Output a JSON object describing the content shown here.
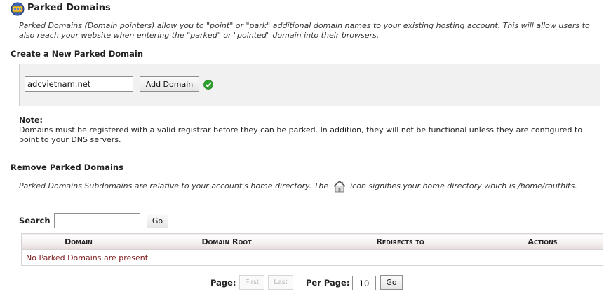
{
  "header": {
    "title": "Parked Domains",
    "icon": "parked-domains-icon",
    "intro": "Parked Domains (Domain pointers) allow you to \"point\" or \"park\" additional domain names to your existing hosting account. This will allow users to also reach your website when entering the \"parked\" or \"pointed\" domain into their browsers."
  },
  "create": {
    "heading": "Create a New Parked Domain",
    "domain_value": "adcvietnam.net",
    "add_label": "Add Domain",
    "status_icon": "valid-check-icon"
  },
  "note": {
    "heading": "Note:",
    "text": "Domains must be registered with a valid registrar before they can be parked. In addition, they will not be functional unless they are configured to point to your DNS servers."
  },
  "remove": {
    "heading": "Remove Parked Domains",
    "desc_before": "Parked Domains Subdomains are relative to your account's home directory. The",
    "desc_after": "icon signifies your home directory which is /home/rauthits.",
    "home_icon": "home-icon"
  },
  "search": {
    "label": "Search",
    "value": "",
    "go_label": "Go"
  },
  "table": {
    "columns": [
      "Domain",
      "Domain Root",
      "Redirects to",
      "Actions"
    ],
    "empty_message": "No Parked Domains are present"
  },
  "pager": {
    "page_label": "Page:",
    "first_label": "First",
    "last_label": "Last",
    "per_page_label": "Per Page:",
    "per_page_value": "10",
    "go_label": "Go"
  },
  "colors": {
    "empty_message": "#7b1a1a",
    "check_green": "#2ea02e"
  }
}
